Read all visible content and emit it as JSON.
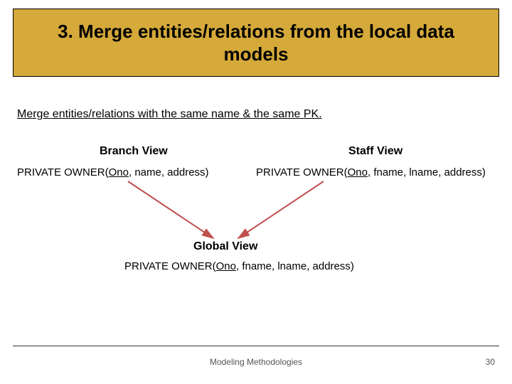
{
  "title": "3. Merge entities/relations from the local data models",
  "subtitle": "Merge entities/relations with the same name & the same PK.",
  "views": {
    "branch": {
      "label": "Branch View",
      "relation_prefix": "PRIVATE OWNER(",
      "relation_pk": "Ono",
      "relation_suffix": ", name, address)"
    },
    "staff": {
      "label": "Staff View",
      "relation_prefix": "PRIVATE OWNER(",
      "relation_pk": "Ono",
      "relation_suffix": ", fname, lname, address)"
    },
    "global": {
      "label": "Global View",
      "relation_prefix": "PRIVATE OWNER(",
      "relation_pk": "Ono",
      "relation_suffix": ", fname, lname, address)"
    }
  },
  "footer": {
    "center": "Modeling Methodologies",
    "page": "30"
  },
  "colors": {
    "title_band": "#d5a93a",
    "arrow": "#c0504d"
  }
}
